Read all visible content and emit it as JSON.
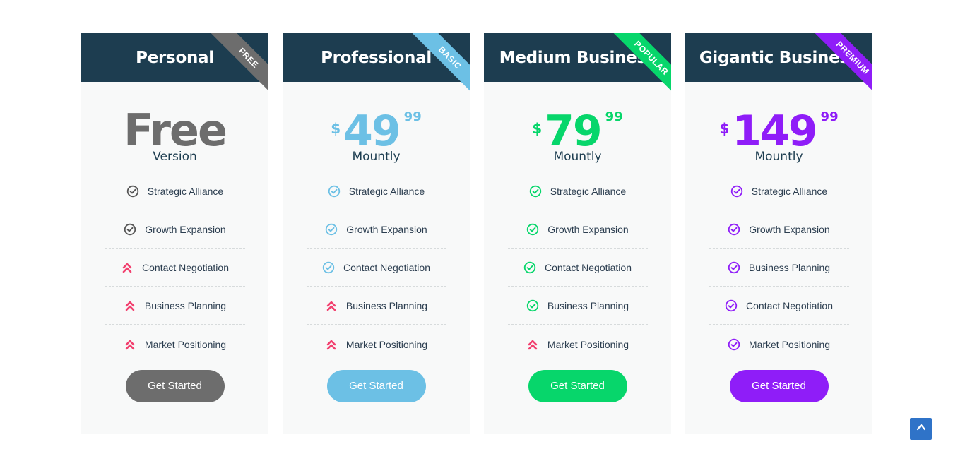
{
  "colors": {
    "header_bg": "#1d3d50",
    "card_bg": "#f8f9f9",
    "cross_icon": "#f2416f",
    "scroll_top_bg": "#2f73c8"
  },
  "plans": [
    {
      "title": "Personal",
      "ribbon": "FREE",
      "accent": "#6d6d6d",
      "ribbon_color": "#6d6d6d",
      "price_free": "Free",
      "price_sub": "Version",
      "features": [
        {
          "label": "Strategic Alliance",
          "icon": "check-circle-icon"
        },
        {
          "label": "Growth Expansion",
          "icon": "check-circle-icon"
        },
        {
          "label": "Contact Negotiation",
          "icon": "double-chevron-up-icon"
        },
        {
          "label": "Business Planning",
          "icon": "double-chevron-up-icon"
        },
        {
          "label": "Market Positioning",
          "icon": "double-chevron-up-icon"
        }
      ],
      "button": "Get Started"
    },
    {
      "title": "Professional",
      "ribbon": "BASIC",
      "accent": "#6cc0e5",
      "ribbon_color": "#6cc0e5",
      "currency": "$",
      "amount": "49",
      "cents": "99",
      "period": "Mountly",
      "features": [
        {
          "label": "Strategic Alliance",
          "icon": "check-circle-icon"
        },
        {
          "label": "Growth Expansion",
          "icon": "check-circle-icon"
        },
        {
          "label": "Contact Negotiation",
          "icon": "check-circle-icon"
        },
        {
          "label": "Business Planning",
          "icon": "double-chevron-up-icon"
        },
        {
          "label": "Market Positioning",
          "icon": "double-chevron-up-icon"
        }
      ],
      "button": "Get Started"
    },
    {
      "title": "Medium Business",
      "ribbon": "POPULAR",
      "accent": "#07d66b",
      "ribbon_color": "#07d66b",
      "currency": "$",
      "amount": "79",
      "cents": "99",
      "period": "Mountly",
      "features": [
        {
          "label": "Strategic Alliance",
          "icon": "check-circle-icon"
        },
        {
          "label": "Growth Expansion",
          "icon": "check-circle-icon"
        },
        {
          "label": "Contact Negotiation",
          "icon": "check-circle-icon"
        },
        {
          "label": "Business Planning",
          "icon": "check-circle-icon"
        },
        {
          "label": "Market Positioning",
          "icon": "double-chevron-up-icon"
        }
      ],
      "button": "Get Started"
    },
    {
      "title": "Gigantic Business",
      "ribbon": "PREMIUM",
      "accent": "#8f1df8",
      "ribbon_color": "#8f1df8",
      "currency": "$",
      "amount": "149",
      "cents": "99",
      "period": "Mountly",
      "features": [
        {
          "label": "Strategic Alliance",
          "icon": "check-circle-icon"
        },
        {
          "label": "Growth Expansion",
          "icon": "check-circle-icon"
        },
        {
          "label": "Business Planning",
          "icon": "check-circle-icon"
        },
        {
          "label": "Contact Negotiation",
          "icon": "check-circle-icon"
        },
        {
          "label": "Market Positioning",
          "icon": "check-circle-icon"
        }
      ],
      "button": "Get Started"
    }
  ],
  "scroll_top": {
    "icon": "chevron-up-icon"
  }
}
